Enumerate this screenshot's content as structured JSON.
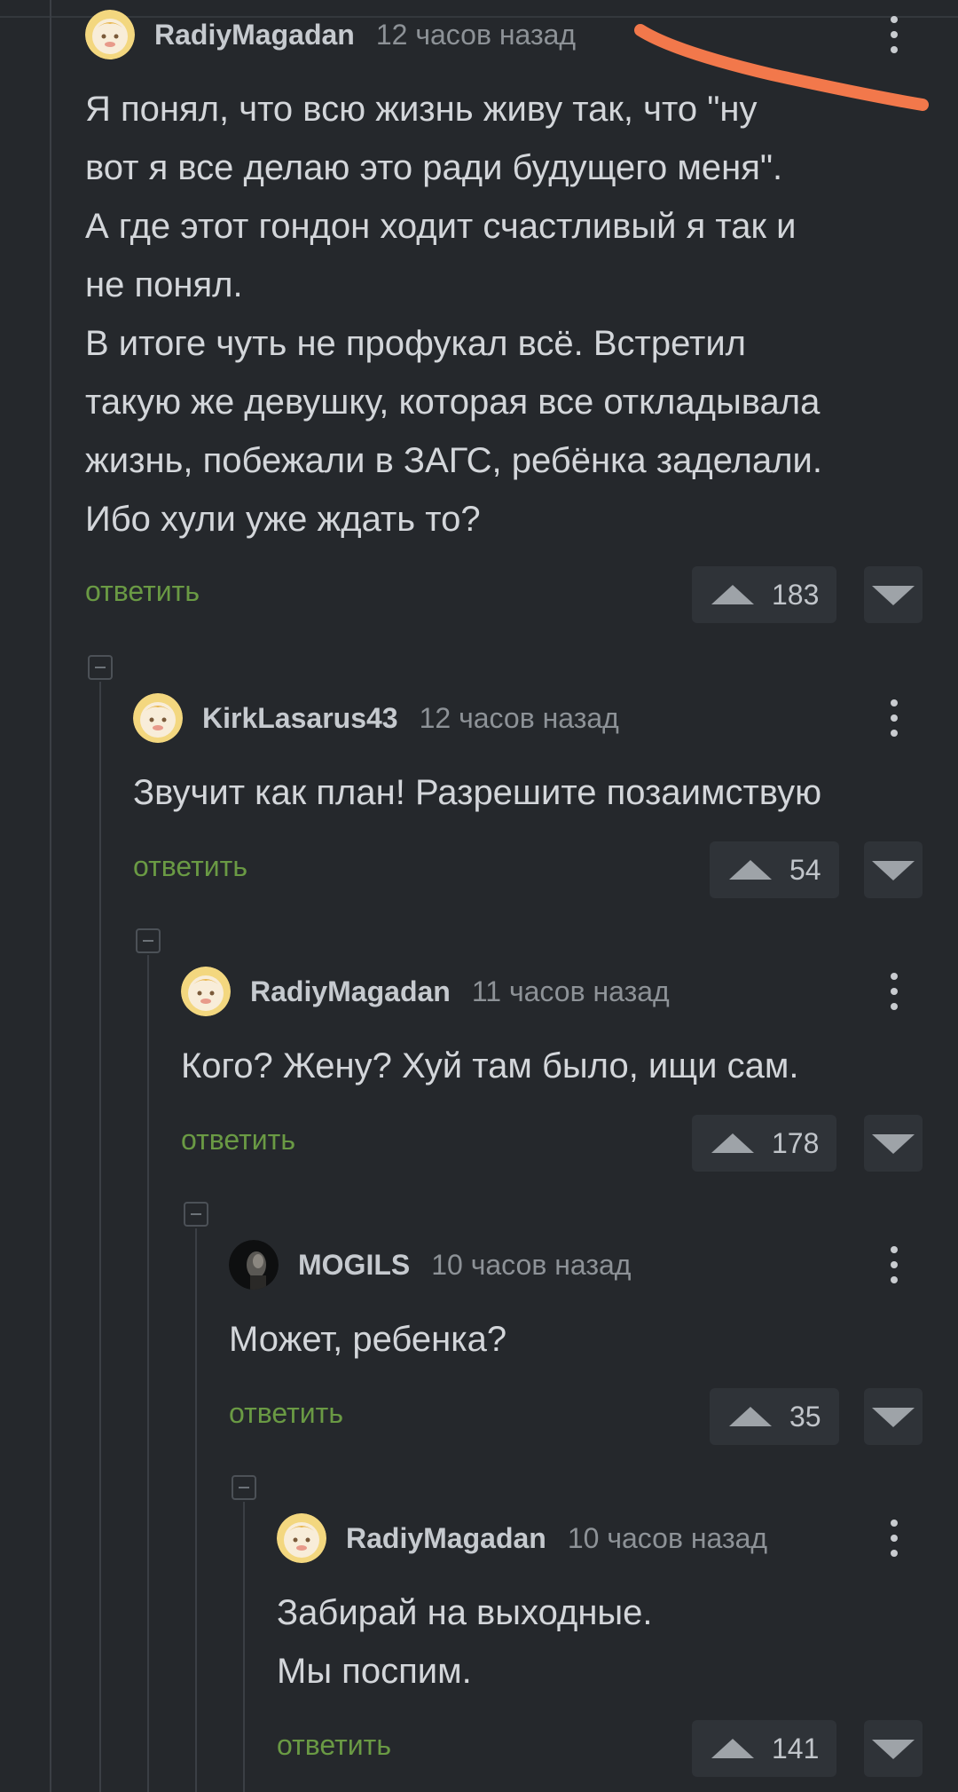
{
  "reply_label": "ответить",
  "comments": [
    {
      "author": "RadiyMagadan",
      "time": "12 часов назад",
      "text": "Я понял, что всю жизнь живу так, что \"ну\nвот я все делаю это ради будущего меня\".\nА где этот гондон ходит счастливый я так и\nне понял.\nВ итоге чуть не профукал всё. Встретил\nтакую же девушку, которая все откладывала\nжизнь, побежали в ЗАГС, ребёнка заделали.\nИбо хули уже ждать то?",
      "score": "183",
      "avatar": "baby-face"
    },
    {
      "author": "KirkLasarus43",
      "time": "12 часов назад",
      "text": "Звучит как план! Разрешите позаимствую",
      "score": "54",
      "avatar": "baby-face"
    },
    {
      "author": "RadiyMagadan",
      "time": "11 часов назад",
      "text": "Кого? Жену? Хуй там было, ищи сам.",
      "score": "178",
      "avatar": "baby-face"
    },
    {
      "author": "MOGILS",
      "time": "10 часов назад",
      "text": "Может, ребенка?",
      "score": "35",
      "avatar": "dark-portrait"
    },
    {
      "author": "RadiyMagadan",
      "time": "10 часов назад",
      "text": "Забирай на выходные.\nМы поспим.",
      "score": "141",
      "avatar": "baby-face"
    }
  ],
  "colors": {
    "background": "#25282c",
    "reply_link": "#6a9a44",
    "annotation_stroke": "#f2784b"
  },
  "icons": [
    "collapse-icon",
    "more-vertical-icon",
    "upvote-icon",
    "downvote-icon"
  ]
}
